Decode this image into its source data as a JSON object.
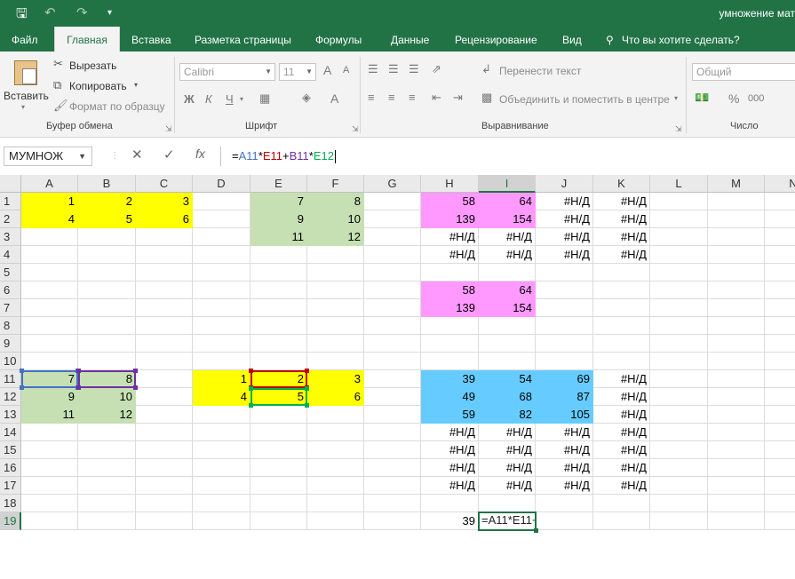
{
  "window": {
    "title": "умножение мат"
  },
  "colors": {
    "brand": "#217346",
    "yellow": "#ffff00",
    "green_fill": "#c6e0b4",
    "pink": "#ff99ff",
    "blue": "#66ccff",
    "sel_blue": "#4472c4",
    "sel_purple": "#7030a0",
    "sel_red": "#c00000",
    "sel_green": "#00b050"
  },
  "quick_access": {
    "save_icon": "save-icon",
    "undo_icon": "undo-icon",
    "redo_icon": "redo-icon",
    "customize_icon": "customize-icon"
  },
  "tabs": [
    {
      "label": "Файл",
      "active": false
    },
    {
      "label": "Главная",
      "active": true
    },
    {
      "label": "Вставка",
      "active": false
    },
    {
      "label": "Разметка страницы",
      "active": false
    },
    {
      "label": "Формулы",
      "active": false
    },
    {
      "label": "Данные",
      "active": false
    },
    {
      "label": "Рецензирование",
      "active": false
    },
    {
      "label": "Вид",
      "active": false
    }
  ],
  "tell_me": "Что вы хотите сделать?",
  "ribbon": {
    "clipboard": {
      "paste": "Вставить",
      "cut": "Вырезать",
      "copy": "Копировать",
      "format_painter": "Формат по образцу",
      "label": "Буфер обмена"
    },
    "font": {
      "name": "Calibri",
      "size": "11",
      "bold": "Ж",
      "italic": "К",
      "underline": "Ч",
      "grow": "A",
      "shrink": "A",
      "color": "A",
      "label": "Шрифт"
    },
    "alignment": {
      "wrap": "Перенести текст",
      "merge": "Объединить и поместить в центре",
      "label": "Выравнивание"
    },
    "number": {
      "format": "Общий",
      "percent": "%",
      "comma": "000",
      "label": "Число"
    }
  },
  "formula_bar": {
    "name_box": "МУМНОЖ",
    "cancel": "✕",
    "enter": "✓",
    "fx": "fx",
    "parts": [
      {
        "text": "=",
        "color": "#000000"
      },
      {
        "text": "A11",
        "color": "#4472c4"
      },
      {
        "text": "*",
        "color": "#000000"
      },
      {
        "text": "E11",
        "color": "#c00000"
      },
      {
        "text": "+",
        "color": "#000000"
      },
      {
        "text": "B11",
        "color": "#7030a0"
      },
      {
        "text": "*",
        "color": "#000000"
      },
      {
        "text": "E12",
        "color": "#00b050"
      }
    ]
  },
  "columns": [
    "A",
    "B",
    "C",
    "D",
    "E",
    "F",
    "G",
    "H",
    "I",
    "J",
    "K",
    "L",
    "M",
    "N"
  ],
  "selected_column": "I",
  "selected_row": 19,
  "rows": [
    1,
    2,
    3,
    4,
    5,
    6,
    7,
    8,
    9,
    10,
    11,
    12,
    13,
    14,
    15,
    16,
    17,
    18,
    19
  ],
  "cells": [
    {
      "ref": "A1",
      "v": "1",
      "fill": "yellow"
    },
    {
      "ref": "B1",
      "v": "2",
      "fill": "yellow"
    },
    {
      "ref": "C1",
      "v": "3",
      "fill": "yellow"
    },
    {
      "ref": "A2",
      "v": "4",
      "fill": "yellow"
    },
    {
      "ref": "B2",
      "v": "5",
      "fill": "yellow"
    },
    {
      "ref": "C2",
      "v": "6",
      "fill": "yellow"
    },
    {
      "ref": "E1",
      "v": "7",
      "fill": "green_fill"
    },
    {
      "ref": "F1",
      "v": "8",
      "fill": "green_fill"
    },
    {
      "ref": "E2",
      "v": "9",
      "fill": "green_fill"
    },
    {
      "ref": "F2",
      "v": "10",
      "fill": "green_fill"
    },
    {
      "ref": "E3",
      "v": "11",
      "fill": "green_fill"
    },
    {
      "ref": "F3",
      "v": "12",
      "fill": "green_fill"
    },
    {
      "ref": "H1",
      "v": "58",
      "fill": "pink"
    },
    {
      "ref": "I1",
      "v": "64",
      "fill": "pink"
    },
    {
      "ref": "J1",
      "v": "#Н/Д"
    },
    {
      "ref": "K1",
      "v": "#Н/Д"
    },
    {
      "ref": "H2",
      "v": "139",
      "fill": "pink"
    },
    {
      "ref": "I2",
      "v": "154",
      "fill": "pink"
    },
    {
      "ref": "J2",
      "v": "#Н/Д"
    },
    {
      "ref": "K2",
      "v": "#Н/Д"
    },
    {
      "ref": "H3",
      "v": "#Н/Д"
    },
    {
      "ref": "I3",
      "v": "#Н/Д"
    },
    {
      "ref": "J3",
      "v": "#Н/Д"
    },
    {
      "ref": "K3",
      "v": "#Н/Д"
    },
    {
      "ref": "H4",
      "v": "#Н/Д"
    },
    {
      "ref": "I4",
      "v": "#Н/Д"
    },
    {
      "ref": "J4",
      "v": "#Н/Д"
    },
    {
      "ref": "K4",
      "v": "#Н/Д"
    },
    {
      "ref": "H6",
      "v": "58",
      "fill": "pink"
    },
    {
      "ref": "I6",
      "v": "64",
      "fill": "pink"
    },
    {
      "ref": "H7",
      "v": "139",
      "fill": "pink"
    },
    {
      "ref": "I7",
      "v": "154",
      "fill": "pink"
    },
    {
      "ref": "A11",
      "v": "7",
      "fill": "green_fill",
      "hl": "sel_blue"
    },
    {
      "ref": "B11",
      "v": "8",
      "fill": "green_fill",
      "hl": "sel_purple"
    },
    {
      "ref": "A12",
      "v": "9",
      "fill": "green_fill"
    },
    {
      "ref": "B12",
      "v": "10",
      "fill": "green_fill"
    },
    {
      "ref": "A13",
      "v": "11",
      "fill": "green_fill"
    },
    {
      "ref": "B13",
      "v": "12",
      "fill": "green_fill"
    },
    {
      "ref": "D11",
      "v": "1",
      "fill": "yellow"
    },
    {
      "ref": "E11",
      "v": "2",
      "fill": "yellow",
      "hl": "sel_red"
    },
    {
      "ref": "F11",
      "v": "3",
      "fill": "yellow"
    },
    {
      "ref": "D12",
      "v": "4",
      "fill": "yellow"
    },
    {
      "ref": "E12",
      "v": "5",
      "fill": "yellow",
      "hl": "sel_green"
    },
    {
      "ref": "F12",
      "v": "6",
      "fill": "yellow"
    },
    {
      "ref": "H11",
      "v": "39",
      "fill": "blue"
    },
    {
      "ref": "I11",
      "v": "54",
      "fill": "blue"
    },
    {
      "ref": "J11",
      "v": "69",
      "fill": "blue"
    },
    {
      "ref": "K11",
      "v": "#Н/Д"
    },
    {
      "ref": "H12",
      "v": "49",
      "fill": "blue"
    },
    {
      "ref": "I12",
      "v": "68",
      "fill": "blue"
    },
    {
      "ref": "J12",
      "v": "87",
      "fill": "blue"
    },
    {
      "ref": "K12",
      "v": "#Н/Д"
    },
    {
      "ref": "H13",
      "v": "59",
      "fill": "blue"
    },
    {
      "ref": "I13",
      "v": "82",
      "fill": "blue"
    },
    {
      "ref": "J13",
      "v": "105",
      "fill": "blue"
    },
    {
      "ref": "K13",
      "v": "#Н/Д"
    },
    {
      "ref": "H14",
      "v": "#Н/Д"
    },
    {
      "ref": "I14",
      "v": "#Н/Д"
    },
    {
      "ref": "J14",
      "v": "#Н/Д"
    },
    {
      "ref": "K14",
      "v": "#Н/Д"
    },
    {
      "ref": "H15",
      "v": "#Н/Д"
    },
    {
      "ref": "I15",
      "v": "#Н/Д"
    },
    {
      "ref": "J15",
      "v": "#Н/Д"
    },
    {
      "ref": "K15",
      "v": "#Н/Д"
    },
    {
      "ref": "H16",
      "v": "#Н/Д"
    },
    {
      "ref": "I16",
      "v": "#Н/Д"
    },
    {
      "ref": "J16",
      "v": "#Н/Д"
    },
    {
      "ref": "K16",
      "v": "#Н/Д"
    },
    {
      "ref": "H17",
      "v": "#Н/Д"
    },
    {
      "ref": "I17",
      "v": "#Н/Д"
    },
    {
      "ref": "J17",
      "v": "#Н/Д"
    },
    {
      "ref": "K17",
      "v": "#Н/Д"
    },
    {
      "ref": "H19",
      "v": "39"
    }
  ],
  "edit_cell": {
    "ref": "I19",
    "text": "=A11*E11+"
  }
}
